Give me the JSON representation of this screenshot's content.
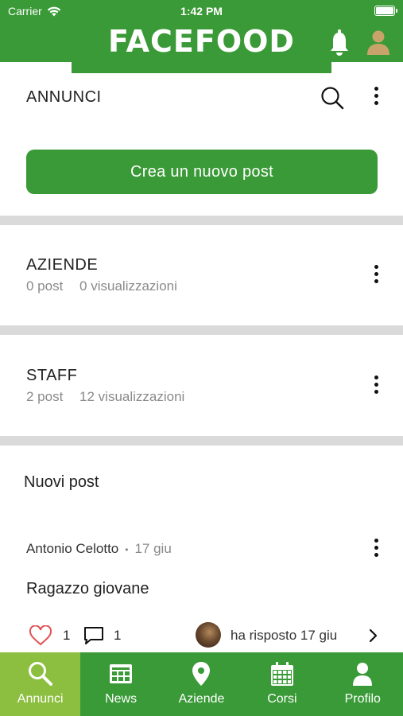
{
  "status_bar": {
    "carrier": "Carrier",
    "time": "1:42 PM"
  },
  "header": {
    "title": "FACEFOOD",
    "icons": [
      "bell-icon",
      "profile-icon"
    ],
    "brand_color": "#3a9a37"
  },
  "annunci": {
    "title": "ANNUNCI",
    "create_button_label": "Crea un nuovo post"
  },
  "categories": [
    {
      "title": "AZIENDE",
      "posts": "0 post",
      "views": "0 visualizzazioni"
    },
    {
      "title": "STAFF",
      "posts": "2 post",
      "views": "12 visualizzazioni"
    }
  ],
  "new_posts": {
    "title": "Nuovi post",
    "post": {
      "author": "Antonio Celotto",
      "date": "17 giu",
      "title": "Ragazzo giovane",
      "likes": "1",
      "comments": "1",
      "reply_text": "ha risposto 17 giu"
    }
  },
  "tabbar": {
    "active_color": "#8cbf3f",
    "tabs": [
      {
        "label": "Annunci",
        "icon": "search-icon",
        "active": true
      },
      {
        "label": "News",
        "icon": "newspaper-icon",
        "active": false
      },
      {
        "label": "Aziende",
        "icon": "map-pin-icon",
        "active": false
      },
      {
        "label": "Corsi",
        "icon": "calendar-icon",
        "active": false
      },
      {
        "label": "Profilo",
        "icon": "user-icon",
        "active": false
      }
    ]
  }
}
